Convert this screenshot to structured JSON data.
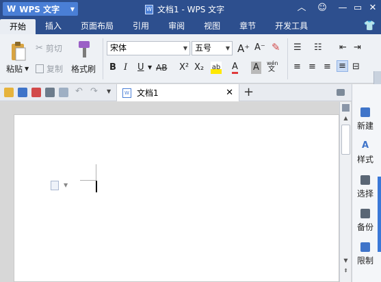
{
  "titlebar": {
    "app_name": "WPS 文字",
    "logo_letter": "W",
    "doc_title": "文档1 - WPS 文字",
    "doc_icon_letter": "W",
    "controls": [
      "︿",
      "☺",
      "—",
      "▭",
      "✕"
    ]
  },
  "menu": {
    "tabs": [
      "开始",
      "插入",
      "页面布局",
      "引用",
      "审阅",
      "视图",
      "章节",
      "开发工具"
    ],
    "active": "开始"
  },
  "ribbon": {
    "paste_label": "粘贴",
    "cut_label": "剪切",
    "copy_label": "复制",
    "format_painter_label": "格式刷",
    "font_name": "宋体",
    "font_size": "五号",
    "bold": "B",
    "italic": "I",
    "underline": "U",
    "strike": "AB",
    "superscript": "X²",
    "subscript": "X₂",
    "grow_font": "A⁺",
    "shrink_font": "A⁻",
    "font_color": "A",
    "char_shading": "A",
    "pinyin": "wén",
    "pinyin_char": "文"
  },
  "doc_tabs": {
    "name": "文档1",
    "icon_letter": "W",
    "close": "✕",
    "new_tab": "+"
  },
  "taskpane": {
    "items": [
      "新建",
      "样式",
      "选择",
      "备份",
      "限制"
    ]
  },
  "colors": {
    "titlebar": "#2d4f8e",
    "accent": "#4a7fd6",
    "ribbon_bg": "#eef1f5"
  }
}
